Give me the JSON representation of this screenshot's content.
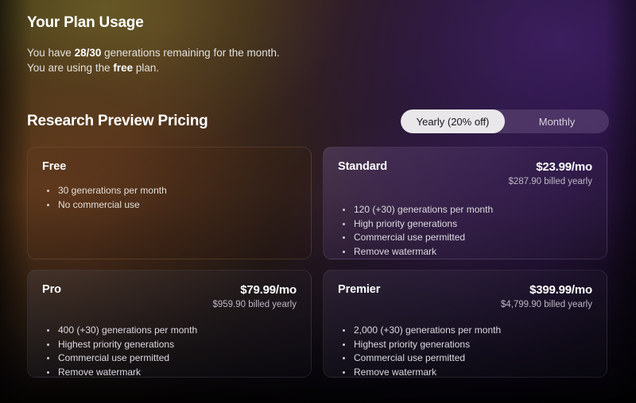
{
  "usage": {
    "title": "Your Plan Usage",
    "line1_pre": "You have ",
    "line1_count": "28/30",
    "line1_post": " generations remaining for the month.",
    "line2_pre": "You are using the ",
    "line2_plan": "free",
    "line2_post": " plan."
  },
  "pricing": {
    "title": "Research Preview Pricing",
    "toggle": {
      "yearly_label": "Yearly (20% off)",
      "monthly_label": "Monthly",
      "selected": "Yearly (20% off)"
    }
  },
  "plans": [
    {
      "name": "Free",
      "price": "",
      "billed": "",
      "features": [
        "30 generations per month",
        "No commercial use"
      ]
    },
    {
      "name": "Standard",
      "price": "$23.99/mo",
      "billed": "$287.90 billed yearly",
      "features": [
        "120 (+30) generations per month",
        "High priority generations",
        "Commercial use permitted",
        "Remove watermark"
      ]
    },
    {
      "name": "Pro",
      "price": "$79.99/mo",
      "billed": "$959.90 billed yearly",
      "features": [
        "400 (+30) generations per month",
        "Highest priority generations",
        "Commercial use permitted",
        "Remove watermark"
      ]
    },
    {
      "name": "Premier",
      "price": "$399.99/mo",
      "billed": "$4,799.90 billed yearly",
      "features": [
        "2,000 (+30) generations per month",
        "Highest priority generations",
        "Commercial use permitted",
        "Remove watermark"
      ]
    }
  ],
  "colors": {
    "accent_purple": "#4a2476",
    "accent_olive": "#7c7630",
    "accent_sienna": "#7e4422",
    "toggle_active_bg": "#e9e7ea",
    "text_primary": "#ffffff",
    "text_muted": "#bdb6c4"
  }
}
